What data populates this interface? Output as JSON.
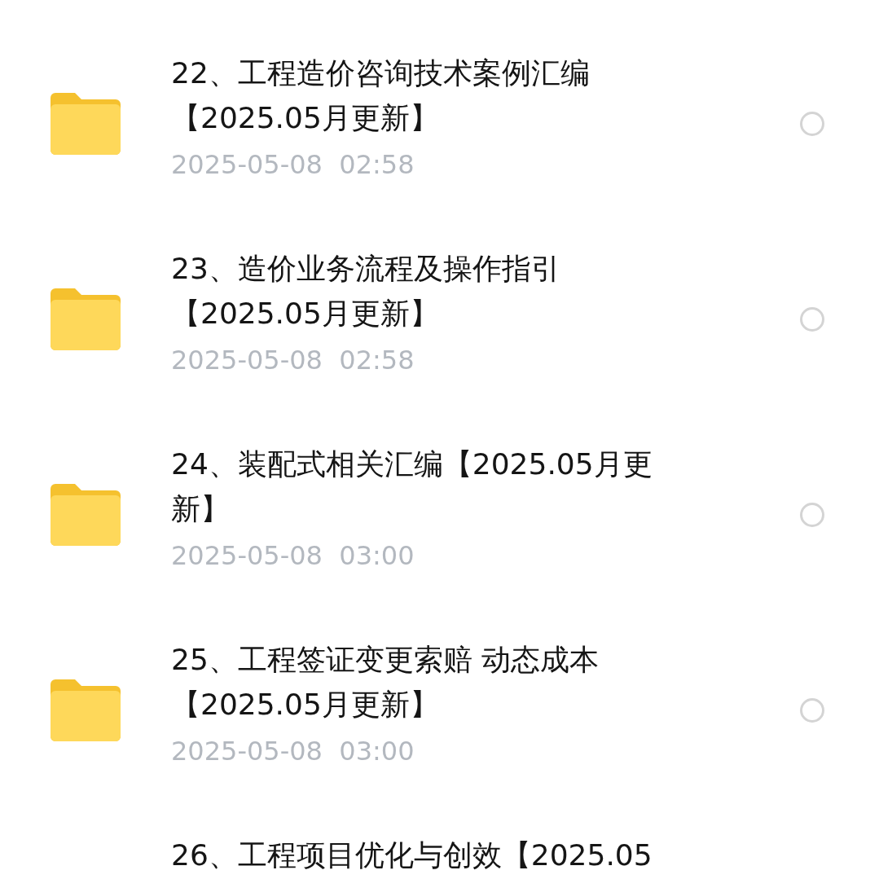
{
  "files": [
    {
      "kind": "full",
      "title": "22、工程造价咨询技术案例汇编【2025.05月更新】",
      "time": "2025-05-08  02:58",
      "selected": false
    },
    {
      "kind": "full",
      "title": "23、造价业务流程及操作指引【2025.05月更新】",
      "time": "2025-05-08  02:58",
      "selected": false
    },
    {
      "kind": "full",
      "title": "24、装配式相关汇编【2025.05月更新】",
      "time": "2025-05-08  03:00",
      "selected": false
    },
    {
      "kind": "full",
      "title": "25、工程签证变更索赔 动态成本【2025.05月更新】",
      "time": "2025-05-08  03:00",
      "selected": false
    },
    {
      "kind": "cut",
      "title": "26、工程项目优化与创效【2025.05"
    }
  ]
}
